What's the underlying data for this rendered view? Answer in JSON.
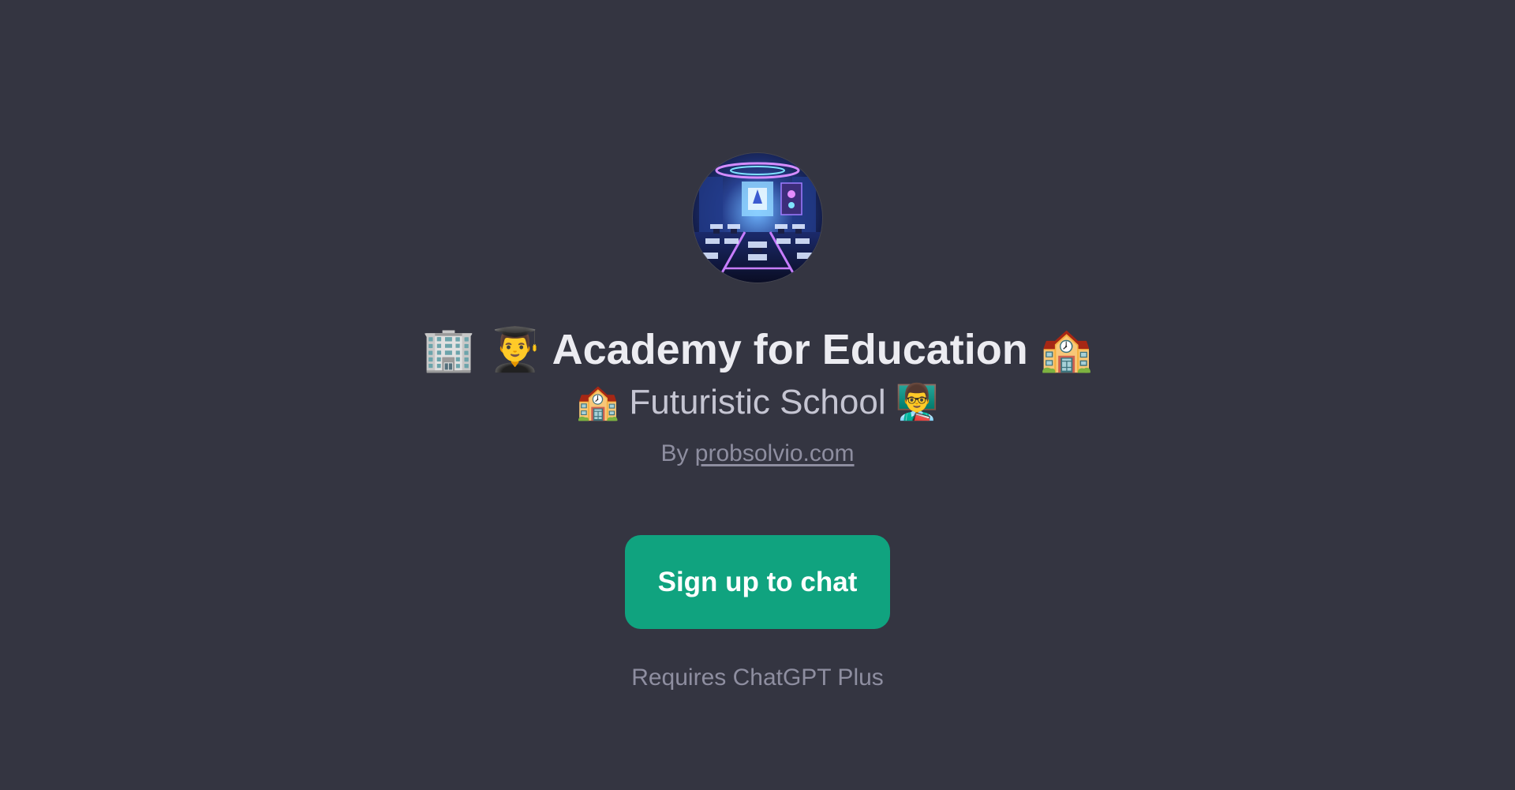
{
  "gpt": {
    "title_prefix_icons": "🏢 👨‍🎓",
    "title": "Academy for Education",
    "title_suffix_icon": "🏫",
    "subtitle_prefix_icon": "🏫",
    "subtitle": "Futuristic School",
    "subtitle_suffix_icon": "👨‍🏫",
    "by_label": "By",
    "author_link": "probsolvio.com"
  },
  "cta": {
    "label": "Sign up to chat"
  },
  "note": "Requires ChatGPT Plus",
  "icons": {
    "avatar": "futuristic-classroom-avatar",
    "title_prefix": [
      "office-building-icon",
      "man-student-icon"
    ],
    "title_suffix": "school-icon",
    "subtitle_prefix": "school-icon",
    "subtitle_suffix": "man-teacher-icon"
  },
  "colors": {
    "background": "#343541",
    "accent": "#10a37f",
    "title": "#ececf1",
    "subtitle": "#c5c5d2",
    "muted": "#8e8ea0"
  }
}
